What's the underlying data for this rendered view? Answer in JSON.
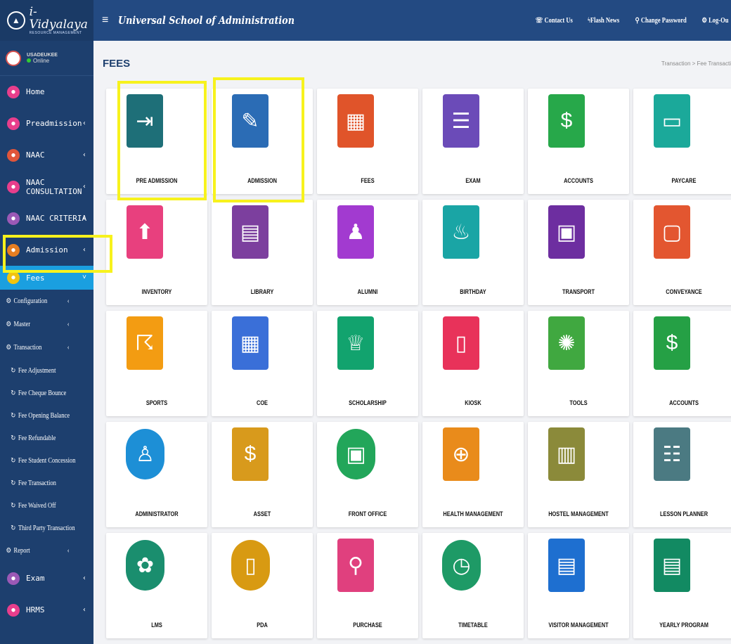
{
  "brand": {
    "title": "i-Vidyalaya",
    "subtitle": "RESOURCE MANAGEMENT"
  },
  "user": {
    "name": "USADEUKEE",
    "status": "Online"
  },
  "header": {
    "menu_icon": "≡",
    "school": "Universal School of Administration",
    "links": [
      "Contact Us",
      "Flash News",
      "Change Password",
      "Log-Ou"
    ]
  },
  "page": {
    "title": "FEES",
    "breadcrumb": "Transaction > Fee Transacti"
  },
  "sidebar": {
    "items": [
      {
        "label": "Home",
        "color": "#e83e8c",
        "chev": ""
      },
      {
        "label": "Preadmission",
        "color": "#e83e8c",
        "chev": "‹"
      },
      {
        "label": "NAAC",
        "color": "#e0553a",
        "chev": "‹"
      },
      {
        "label": "NAAC CONSULTATION",
        "color": "#e83e8c",
        "chev": "‹"
      },
      {
        "label": "NAAC CRITERIA",
        "color": "#9b59b6",
        "chev": "‹"
      },
      {
        "label": "Admission",
        "color": "#e67e22",
        "chev": "‹"
      },
      {
        "label": "Fees",
        "color": "#f1c40f",
        "chev": "˅"
      }
    ],
    "subitems": [
      {
        "label": "Configuration",
        "chev": "‹"
      },
      {
        "label": "Master",
        "chev": "‹"
      },
      {
        "label": "Transaction",
        "chev": "‹"
      }
    ],
    "leaves": [
      "Fee Adjustment",
      "Fee Cheque Bounce",
      "Fee Opening Balance",
      "Fee Refundable",
      "Fee Student Concession",
      "Fee Transaction",
      "Fee Waived Off",
      "Third Party Transaction"
    ],
    "report": {
      "label": "Report",
      "chev": "‹"
    },
    "bottom": [
      {
        "label": "Exam",
        "color": "#9b59b6",
        "chev": "‹"
      },
      {
        "label": "HRMS",
        "color": "#e83e8c",
        "chev": "‹"
      }
    ]
  },
  "modules": [
    {
      "label": "PRE ADMISSION",
      "color": "#1e6f78",
      "icon": "⇥"
    },
    {
      "label": "ADMISSION",
      "color": "#2b6cb5",
      "icon": "✎"
    },
    {
      "label": "FEES",
      "color": "#e0542a",
      "icon": "▦"
    },
    {
      "label": "EXAM",
      "color": "#6b4bb8",
      "icon": "☰"
    },
    {
      "label": "ACCOUNTS",
      "color": "#27a84a",
      "icon": "$"
    },
    {
      "label": "PAYCARE",
      "color": "#1ba99a",
      "icon": "▭"
    },
    {
      "label": "INVENTORY",
      "color": "#e8407e",
      "icon": "⬆"
    },
    {
      "label": "LIBRARY",
      "color": "#7c3f9e",
      "icon": "▤"
    },
    {
      "label": "ALUMNI",
      "color": "#a23ad0",
      "icon": "♟"
    },
    {
      "label": "BIRTHDAY",
      "color": "#1aa5a5",
      "icon": "♨"
    },
    {
      "label": "TRANSPORT",
      "color": "#6d2ea0",
      "icon": "▣"
    },
    {
      "label": "CONVEYANCE",
      "color": "#e35630",
      "icon": "▢"
    },
    {
      "label": "SPORTS",
      "color": "#f39c12",
      "icon": "☈"
    },
    {
      "label": "COE",
      "color": "#3a6fd8",
      "icon": "▦"
    },
    {
      "label": "SCHOLARSHIP",
      "color": "#12a36e",
      "icon": "♕"
    },
    {
      "label": "KIOSK",
      "color": "#e8325a",
      "icon": "▯"
    },
    {
      "label": "TOOLS",
      "color": "#40a840",
      "icon": "✺"
    },
    {
      "label": "ACCOUNTS",
      "color": "#25a045",
      "icon": "$"
    },
    {
      "label": "ADMINISTRATOR",
      "color": "#1d8fd6",
      "icon": "♙",
      "circle": true
    },
    {
      "label": "ASSET",
      "color": "#d89a1c",
      "icon": "$",
      "circle": false
    },
    {
      "label": "FRONT OFFICE",
      "color": "#22a65a",
      "icon": "▣",
      "circle": true
    },
    {
      "label": "HEALTH MANAGEMENT",
      "color": "#e98b1b",
      "icon": "⊕",
      "circle": false
    },
    {
      "label": "HOSTEL MANAGEMENT",
      "color": "#8b8a3a",
      "icon": "▥",
      "circle": false
    },
    {
      "label": "LESSON PLANNER",
      "color": "#4b7a82",
      "icon": "☷",
      "circle": false
    },
    {
      "label": "LMS",
      "color": "#1a8e6e",
      "icon": "✿",
      "circle": true
    },
    {
      "label": "PDA",
      "color": "#d89a12",
      "icon": "▯",
      "circle": true
    },
    {
      "label": "PURCHASE",
      "color": "#e0407e",
      "icon": "⚲",
      "circle": false
    },
    {
      "label": "TIMETABLE",
      "color": "#1e9a66",
      "icon": "◷",
      "circle": true
    },
    {
      "label": "VISITOR MANAGEMENT",
      "color": "#1e6fd0",
      "icon": "▤",
      "circle": false
    },
    {
      "label": "YEARLY PROGRAM",
      "color": "#128a62",
      "icon": "▤",
      "circle": false
    }
  ]
}
